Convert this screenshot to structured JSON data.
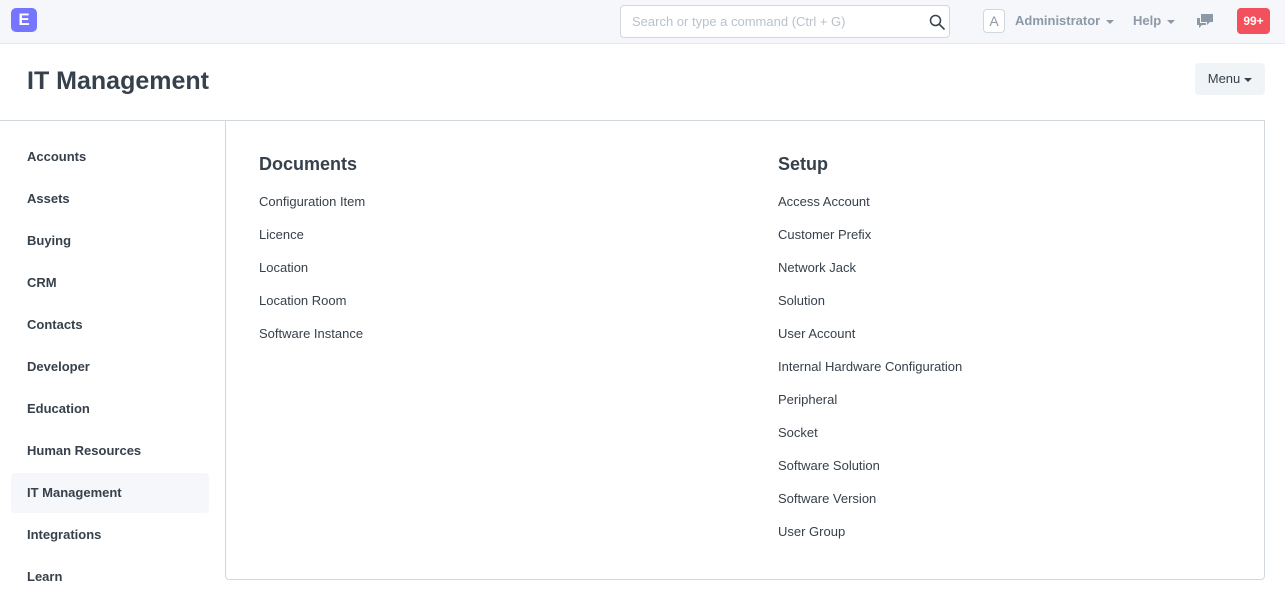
{
  "navbar": {
    "logo_letter": "E",
    "search_placeholder": "Search or type a command (Ctrl + G)",
    "avatar_letter": "A",
    "user_label": "Administrator",
    "help_label": "Help",
    "notification_count": "99+"
  },
  "page": {
    "title": "IT Management",
    "menu_label": "Menu"
  },
  "sidebar": {
    "active": "IT Management",
    "items": [
      "Accounts",
      "Assets",
      "Buying",
      "CRM",
      "Contacts",
      "Developer",
      "Education",
      "Human Resources",
      "IT Management",
      "Integrations",
      "Learn"
    ]
  },
  "sections": {
    "documents": {
      "title": "Documents",
      "links": [
        "Configuration Item",
        "Licence",
        "Location",
        "Location Room",
        "Software Instance"
      ]
    },
    "setup": {
      "title": "Setup",
      "links": [
        "Access Account",
        "Customer Prefix",
        "Network Jack",
        "Solution",
        "User Account",
        "Internal Hardware Configuration",
        "Peripheral",
        "Socket",
        "Software Solution",
        "Software Version",
        "User Group"
      ]
    }
  },
  "colors": {
    "logo": "#7575ff",
    "notification": "#f2505c",
    "text": "#36414c",
    "muted": "#8d99a6"
  },
  "icons": [
    "search-icon",
    "chat-icon",
    "caret-down-icon"
  ]
}
